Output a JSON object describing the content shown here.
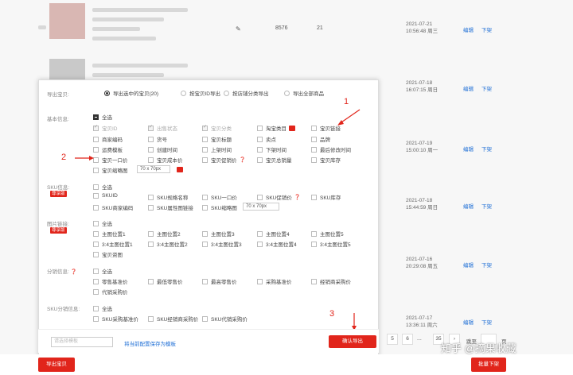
{
  "rows": [
    {
      "date": "2021-07-21",
      "time": "10:56:48 周三",
      "qty": "8576",
      "n": "21"
    },
    {
      "date": "2021-07-18",
      "time": "16:07:15 周日"
    },
    {
      "date": "2021-07-19",
      "time": "15:00:10 周一"
    },
    {
      "date": "2021-07-18",
      "time": "15:44:59 周日"
    },
    {
      "date": "2021-07-16",
      "time": "20:29:08 周五"
    },
    {
      "date": "2021-07-17",
      "time": "13:36:11 周六"
    }
  ],
  "actions": {
    "edit": "编辑",
    "off": "下架"
  },
  "export": {
    "label": "导出宝贝:",
    "options": [
      "导出选中的宝贝(20)",
      "按宝贝ID导出",
      "按店铺分类导出",
      "导出全部商品"
    ]
  },
  "basic": {
    "label": "基本信息:",
    "all": "全选",
    "items": [
      "宝贝ID",
      "出售状态",
      "宝贝分类",
      "淘宝类目",
      "宝贝链接",
      "商家编码",
      "货号",
      "宝贝标题",
      "卖点",
      "品牌",
      "运费模板",
      "创建时间",
      "上架时间",
      "下架时间",
      "最后修改时间",
      "宝贝一口价",
      "宝贝成本价",
      "宝贝促销价",
      "宝贝总销量",
      "宝贝库存",
      "宝贝缩略图"
    ],
    "size": "70 x 70px"
  },
  "sku": {
    "label": "SKU信息:",
    "tag": "尊享版",
    "all": "全选",
    "items": [
      "SKUID",
      "SKU规格名称",
      "SKU一口价",
      "SKU促销价",
      "SKU库存",
      "SKU商家编码",
      "SKU属性图链接",
      "SKU缩略图"
    ],
    "size": "70 x 70px"
  },
  "image": {
    "label": "图片链接:",
    "tag": "尊享版",
    "all": "全选",
    "items": [
      "主图位置1",
      "主图位置2",
      "主图位置3",
      "主图位置4",
      "主图位置5",
      "3:4主图位置1",
      "3:4主图位置2",
      "3:4主图位置3",
      "3:4主图位置4",
      "3:4主图位置5",
      "宝贝资图"
    ]
  },
  "dist": {
    "label": "分销信息:",
    "all": "全选",
    "items": [
      "零售基准价",
      "最低零售价",
      "最高零售价",
      "采购基准价",
      "经销商采购价",
      "代销采购价"
    ]
  },
  "skudist": {
    "label": "SKU分销信息:",
    "all": "全选",
    "items": [
      "SKU采购基准价",
      "SKU经销商采购价",
      "SKU代销采购价"
    ]
  },
  "footer": {
    "template_ph": "请选择模板",
    "save_tpl": "将当前配置保存为模板",
    "confirm": "确认导出"
  },
  "annots": [
    "1",
    "2",
    "3"
  ],
  "pager": {
    "p5": "5",
    "p6": "6",
    "ellipsis": "...",
    "p35": "35",
    "next": "›",
    "goto": "跳至",
    "page": "页"
  },
  "bottom": {
    "export_btn": "导出宝贝",
    "batch_off": "批量下架"
  },
  "watermark": "知乎 @摘果收藏"
}
